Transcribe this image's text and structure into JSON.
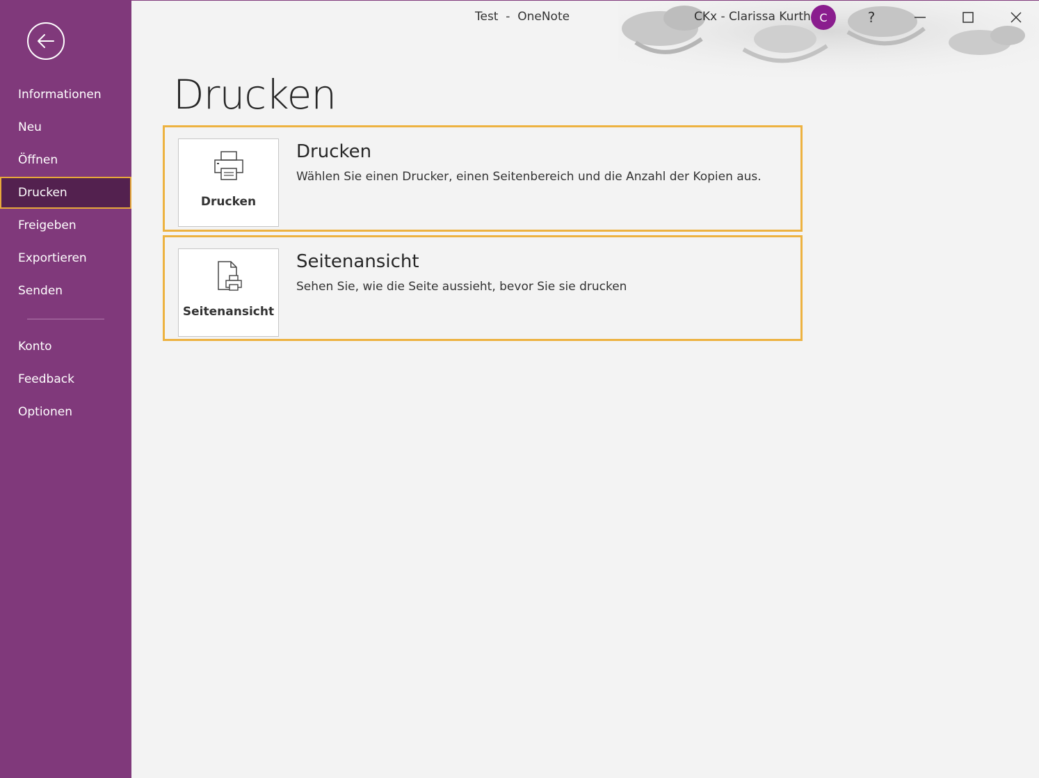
{
  "sidebar": {
    "back_icon": "arrow-left-icon",
    "items": [
      {
        "label": "Informationen"
      },
      {
        "label": "Neu"
      },
      {
        "label": "Öffnen"
      },
      {
        "label": "Drucken",
        "selected": true
      },
      {
        "label": "Freigeben"
      },
      {
        "label": "Exportieren"
      },
      {
        "label": "Senden"
      }
    ],
    "bottom_items": [
      {
        "label": "Konto"
      },
      {
        "label": "Feedback"
      },
      {
        "label": "Optionen"
      }
    ]
  },
  "titlebar": {
    "title": "Test  -  OneNote",
    "user_name": "CKx - Clarissa Kurth",
    "avatar_initial": "C",
    "help_label": "?"
  },
  "main": {
    "page_title": "Drucken",
    "options": [
      {
        "tile_label": "Drucken",
        "icon": "printer-icon",
        "heading": "Drucken",
        "description": "Wählen Sie einen Drucker, einen Seitenbereich und die Anzahl der Kopien aus."
      },
      {
        "tile_label": "Seitenansicht",
        "icon": "print-preview-icon",
        "heading": "Seitenansicht",
        "description": "Sehen Sie, wie die Seite aussieht, bevor Sie sie drucken"
      }
    ]
  },
  "colors": {
    "sidebar": "#80397b",
    "sidebar_selected": "#53214f",
    "accent_border": "#edb240",
    "avatar": "#8a1d8e"
  }
}
